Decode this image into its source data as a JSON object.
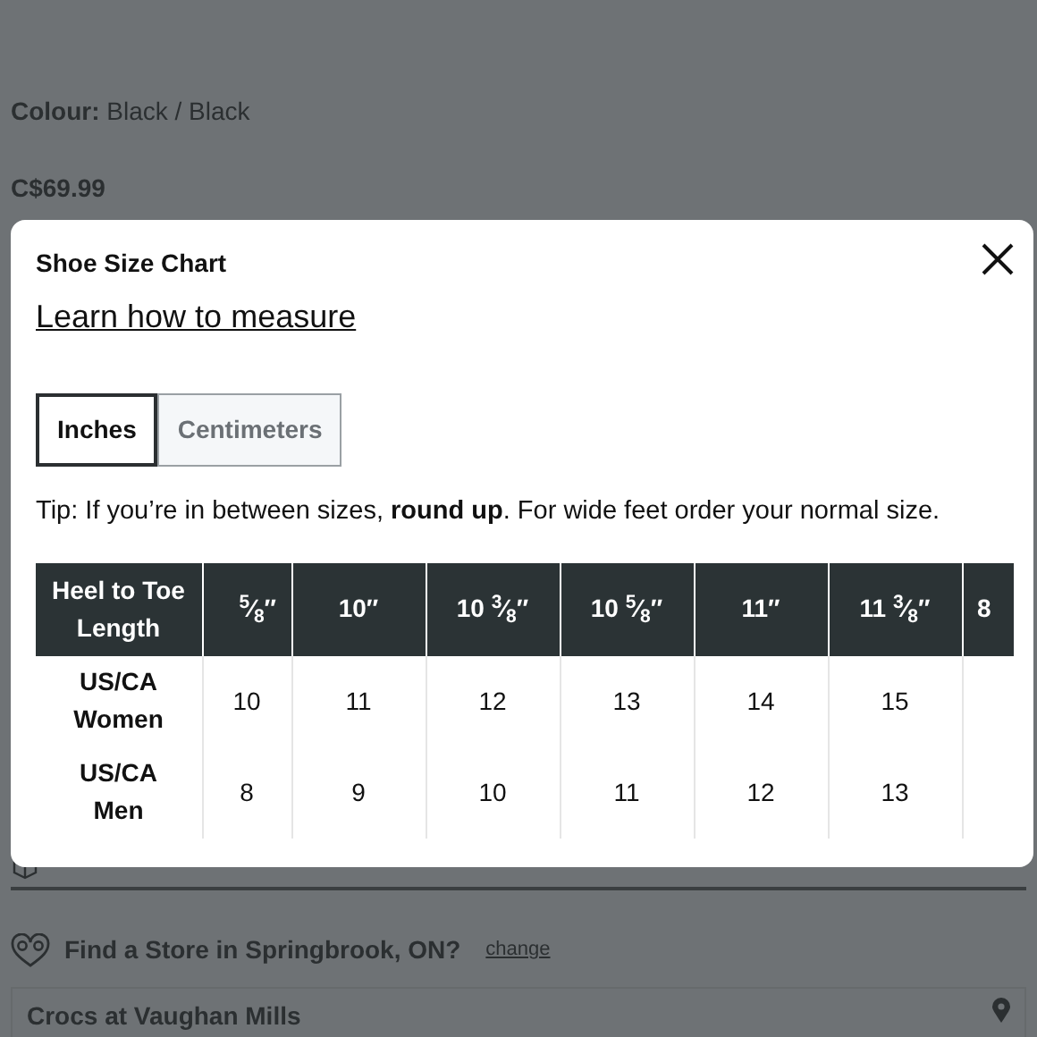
{
  "page": {
    "colour_label": "Colour:",
    "colour_value": "Black / Black",
    "price": "C$69.99",
    "store_prompt": "Find a Store in Springbrook, ON?",
    "store_change": "change",
    "store_name": "Crocs at Vaughan Mills"
  },
  "modal": {
    "title": "Shoe Size Chart",
    "link": "Learn how to measure",
    "units": [
      {
        "label": "Inches",
        "selected": true
      },
      {
        "label": "Centimeters",
        "selected": false
      }
    ],
    "tip": "Tip: If you’re in between sizes, **round up**. For wide feet order your normal size.",
    "table": {
      "header": "Heel to Toe Length",
      "columns": [
        "$^{5}$⁄$_{8}$″",
        "10″",
        "10 $^{3}$⁄$_{8}$″",
        "10 $^{5}$⁄$_{8}$″",
        "11″",
        "11 $^{3}$⁄$_{8}$″",
        "8"
      ],
      "rows": [
        {
          "label": "US/CA Women",
          "cells": [
            "10",
            "11",
            "12",
            "13",
            "14",
            "15"
          ]
        },
        {
          "label": "US/CA Men",
          "cells": [
            "8",
            "9",
            "10",
            "11",
            "12",
            "13"
          ]
        }
      ]
    }
  }
}
